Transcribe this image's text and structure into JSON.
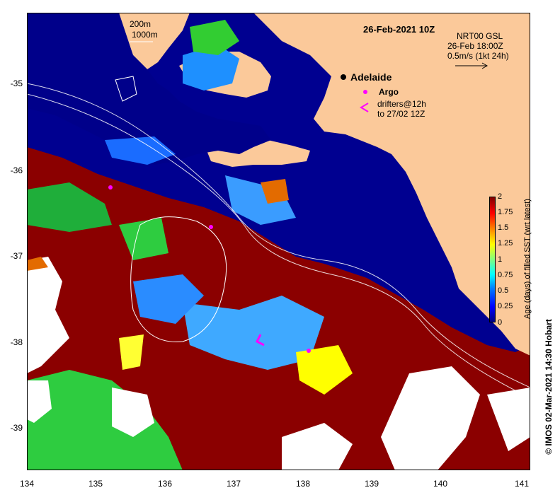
{
  "map": {
    "title": "26-Feb-2021 10Z",
    "depth_legend": [
      "200m",
      "1000m"
    ],
    "current_legend": {
      "product": "NRT00 GSL",
      "time": "26-Feb 18:00Z",
      "scale": "0.5m/s (1kt 24h)"
    },
    "city": "Adelaide",
    "argo_label": "Argo",
    "drifters_label": [
      "drifters@12h",
      "to 27/02 12Z"
    ],
    "colors": {
      "land": "#fbc99a",
      "deep_ocean": "#000080",
      "old_sst": "#8b0000",
      "white_gap": "#ffffff",
      "argo": "#ff00ff"
    }
  },
  "axes": {
    "longitude_ticks": [
      "134",
      "135",
      "136",
      "137",
      "138",
      "139",
      "140",
      "141"
    ],
    "latitude_ticks": [
      "-35",
      "-36",
      "-37",
      "-38",
      "-39"
    ]
  },
  "colorbar": {
    "label": "Age (days) of filled SST (wrt latest)",
    "ticks": [
      "2",
      "1.75",
      "1.5",
      "1.25",
      "1",
      "0.75",
      "0.5",
      "0.25",
      "0"
    ],
    "range": [
      0,
      2
    ],
    "colormap": [
      "#00007f",
      "#0000ff",
      "#007fff",
      "#00ffff",
      "#7fff7f",
      "#ffff00",
      "#ff7f00",
      "#ff0000",
      "#7f0000"
    ]
  },
  "credit": "© IMOS 02-Mar-2021 14:30 Hobart"
}
